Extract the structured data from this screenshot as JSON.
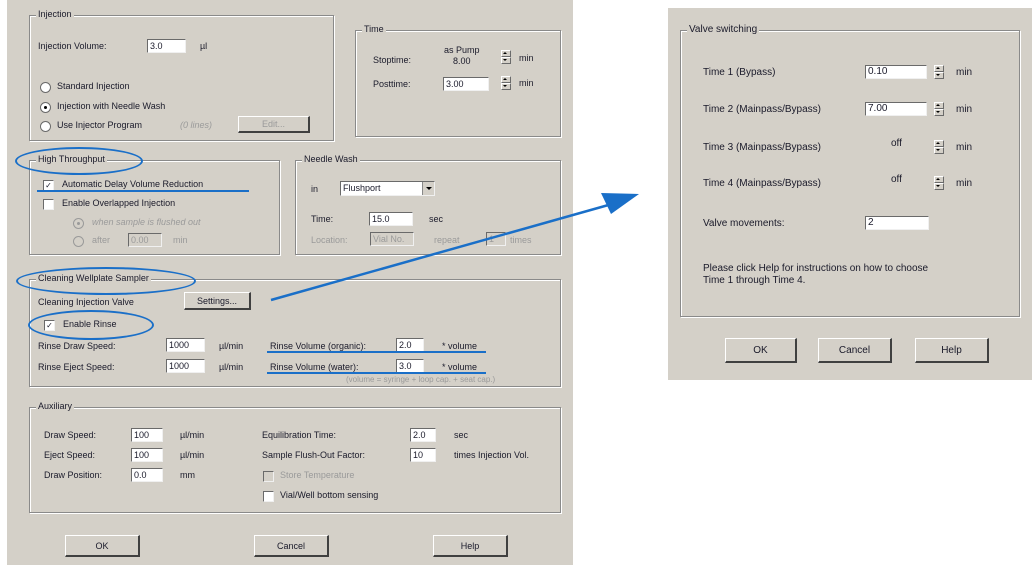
{
  "left": {
    "injection": {
      "legend": "Injection",
      "volume_label": "Injection Volume:",
      "volume_value": "3.0",
      "volume_unit": "µl",
      "opt_standard": "Standard Injection",
      "opt_needle_wash": "Injection with Needle Wash",
      "opt_program": "Use Injector Program",
      "program_status": "(0 lines)",
      "edit_label": "Edit..."
    },
    "time": {
      "legend": "Time",
      "stoptime_label": "Stoptime:",
      "stoptime_value_line1": "as Pump",
      "stoptime_value_line2": "8.00",
      "stoptime_unit": "min",
      "posttime_label": "Posttime:",
      "posttime_value": "3.00",
      "posttime_unit": "min"
    },
    "high_throughput": {
      "legend": "High Throughput",
      "auto_delay": "Automatic Delay Volume Reduction",
      "overlapped": "Enable Overlapped Injection",
      "when_sample": "when sample is flushed out",
      "after": "after",
      "after_value": "0.00",
      "after_unit": "min"
    },
    "needle_wash": {
      "legend": "Needle Wash",
      "in_label": "in",
      "location": "Flushport",
      "time_label": "Time:",
      "time_value": "15.0",
      "time_unit": "sec",
      "location_label": "Location:",
      "location_value": "Vial No.",
      "repeat_label": "repeat",
      "repeat_value": "1",
      "repeat_unit": "times"
    },
    "cleaning": {
      "legend": "Cleaning Wellplate Sampler",
      "valve_label": "Cleaning Injection Valve",
      "settings_label": "Settings...",
      "enable_rinse": "Enable Rinse",
      "draw_label": "Rinse Draw Speed:",
      "draw_value": "1000",
      "draw_unit": "µl/min",
      "eject_label": "Rinse Eject Speed:",
      "eject_value": "1000",
      "eject_unit": "µl/min",
      "vol_org_label": "Rinse Volume (organic):",
      "vol_org_value": "2.0",
      "vol_org_unit": "* volume",
      "vol_wat_label": "Rinse Volume (water):",
      "vol_wat_value": "3.0",
      "vol_wat_unit": "* volume",
      "note": "(volume = syringe + loop cap. + seat cap.)"
    },
    "auxiliary": {
      "legend": "Auxiliary",
      "draw_label": "Draw Speed:",
      "draw_value": "100",
      "draw_unit": "µl/min",
      "eject_label": "Eject Speed:",
      "eject_value": "100",
      "eject_unit": "µl/min",
      "position_label": "Draw Position:",
      "position_value": "0.0",
      "position_unit": "mm",
      "equil_label": "Equilibration Time:",
      "equil_value": "2.0",
      "equil_unit": "sec",
      "flush_label": "Sample Flush-Out Factor:",
      "flush_value": "10",
      "flush_unit": "times Injection Vol.",
      "store_temp": "Store Temperature",
      "vial_sensing": "Vial/Well bottom sensing"
    },
    "buttons": {
      "ok": "OK",
      "cancel": "Cancel",
      "help": "Help"
    }
  },
  "right": {
    "legend": "Valve switching",
    "rows": [
      {
        "label": "Time 1 (Bypass)",
        "value": "0.10",
        "unit": "min"
      },
      {
        "label": "Time 2 (Mainpass/Bypass)",
        "value": "7.00",
        "unit": "min"
      },
      {
        "label": "Time 3 (Mainpass/Bypass)",
        "value": "off",
        "unit": "min"
      },
      {
        "label": "Time 4 (Mainpass/Bypass)",
        "value": "off",
        "unit": "min"
      }
    ],
    "movements_label": "Valve movements:",
    "movements_value": "2",
    "help_text_1": "Please click Help for instructions on how to choose",
    "help_text_2": "Time 1 through Time 4.",
    "buttons": {
      "ok": "OK",
      "cancel": "Cancel",
      "help": "Help"
    }
  },
  "colors": {
    "highlight": "#1a6fc8",
    "dialog": "#d4d0c8"
  },
  "icons": [
    "radio-button",
    "checkbox",
    "spin-button",
    "dropdown-arrow",
    "arrow-annotation"
  ]
}
